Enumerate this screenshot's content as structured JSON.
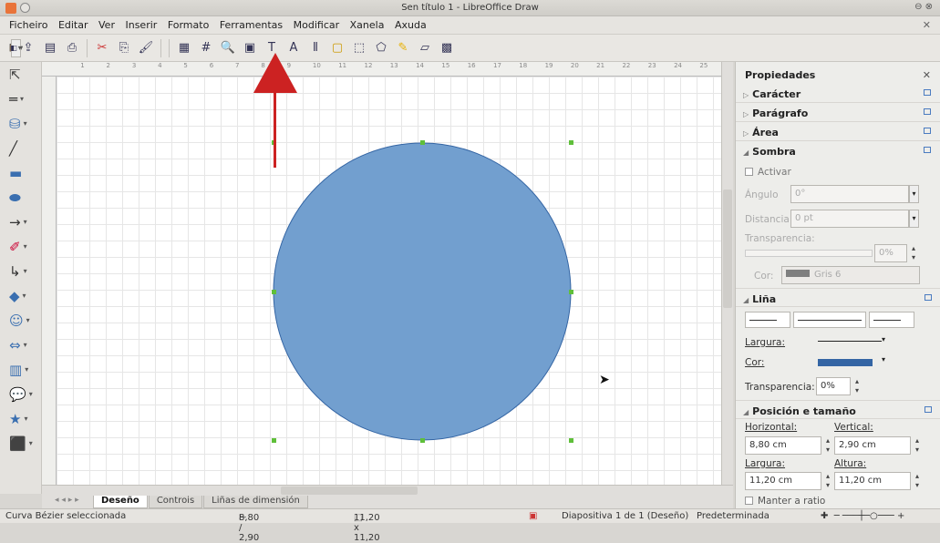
{
  "window": {
    "title": "Sen título 1 - LibreOffice Draw"
  },
  "menu": [
    "Ficheiro",
    "Editar",
    "Ver",
    "Inserir",
    "Formato",
    "Ferramentas",
    "Modificar",
    "Xanela",
    "Axuda"
  ],
  "ruler_ticks": [
    "1",
    "2",
    "3",
    "4",
    "5",
    "6",
    "7",
    "8",
    "9",
    "10",
    "11",
    "12",
    "13",
    "14",
    "15",
    "16",
    "17",
    "18",
    "19",
    "20",
    "21",
    "22",
    "23",
    "24",
    "25"
  ],
  "tabs": {
    "deseno": "Deseño",
    "controis": "Controis",
    "linas": "Liñas de dimensión"
  },
  "status": {
    "selection": "Curva Bézier seleccionada",
    "position": "8,80 / 2,90",
    "size": "11,20 x 11,20",
    "slide": "Diapositiva 1 de 1 (Deseño)",
    "layout": "Predeterminada"
  },
  "sidebar": {
    "title": "Propiedades",
    "sections": {
      "caracter": "Carácter",
      "paragrafo": "Parágrafo",
      "area": "Área",
      "sombra": "Sombra",
      "lina": "Liña",
      "posicion": "Posición e tamaño"
    },
    "shadow": {
      "activar": "Activar",
      "angulo_label": "Ángulo",
      "angulo": "0°",
      "distancia_label": "Distancia",
      "distancia": "0 pt",
      "transparencia_label": "Transparencia:",
      "transparencia": "0%",
      "cor_label": "Cor:",
      "cor": "Gris 6"
    },
    "line": {
      "largura_label": "Largura:",
      "cor_label": "Cor:",
      "transparencia_label": "Transparencia:",
      "transparencia": "0%"
    },
    "position": {
      "horizontal_label": "Horizontal:",
      "vertical_label": "Vertical:",
      "horizontal": "8,80 cm",
      "vertical": "2,90 cm",
      "largura_label": "Largura:",
      "altura_label": "Altura:",
      "largura": "11,20 cm",
      "altura": "11,20 cm",
      "mantener": "Manter a ratio"
    }
  },
  "colors": {
    "shape_fill": "#729fcf",
    "shape_stroke": "#3465a4",
    "handle": "#5fbf3a",
    "arrow": "#cc2222",
    "line_color": "#3465a4"
  }
}
